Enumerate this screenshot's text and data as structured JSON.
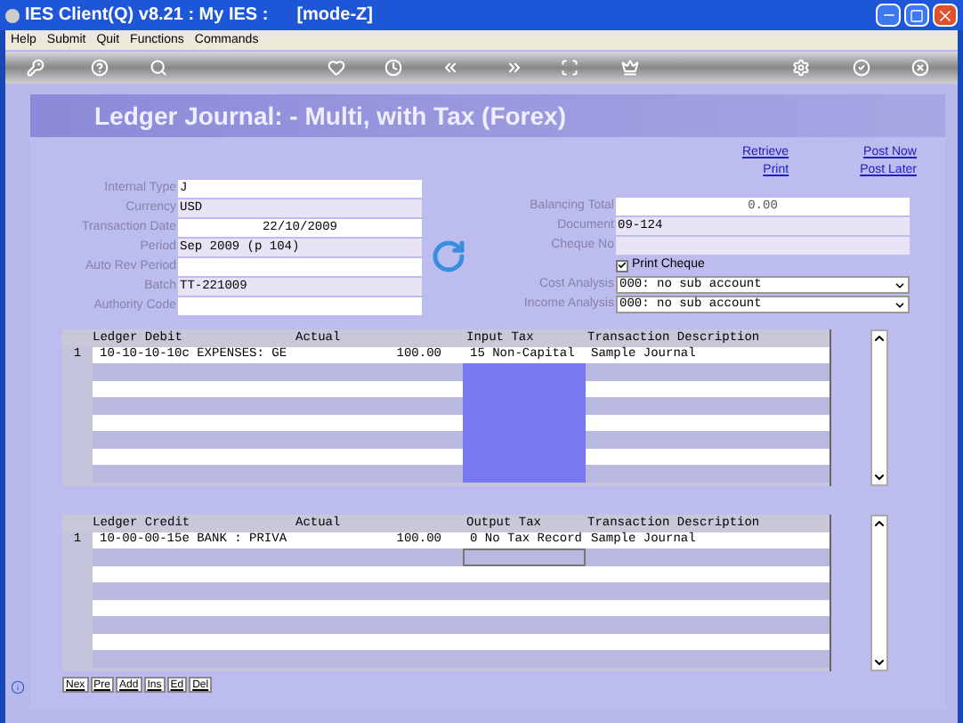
{
  "window": {
    "title": "IES Client(Q) v8.21 : My IES :",
    "mode": "[mode-Z]"
  },
  "menu": [
    "Help",
    "Submit",
    "Quit",
    "Functions",
    "Commands"
  ],
  "heading": "Ledger Journal: - Multi, with Tax (Forex)",
  "links": [
    {
      "label": "Retrieve"
    },
    {
      "label": "Post Now"
    },
    {
      "label": "Print"
    },
    {
      "label": "Post Later"
    }
  ],
  "left_fields": [
    {
      "kind": "text",
      "label": "Internal Type",
      "value": "J"
    },
    {
      "kind": "text",
      "label": "Currency",
      "value": "USD"
    },
    {
      "kind": "date",
      "label": "Transaction Date",
      "value": "22/10/2009"
    },
    {
      "kind": "text",
      "label": "Period",
      "value": "Sep 2009 (p 104)"
    },
    {
      "kind": "text",
      "label": "Auto Rev Period"
    },
    {
      "kind": "text",
      "label": "Batch",
      "value": "TT-221009"
    },
    {
      "kind": "text",
      "label": "Authority Code"
    }
  ],
  "right_fields": [
    {
      "kind": "total",
      "label": "Balancing Total",
      "value": "0.00"
    },
    {
      "kind": "text",
      "label": "Document",
      "value": "09-124"
    },
    {
      "kind": "text",
      "label": "Cheque No"
    },
    {
      "kind": "checkbox",
      "label": "Print Cheque",
      "checked": true
    },
    {
      "kind": "select",
      "label": "Cost Analysis",
      "value": "000: no sub account"
    },
    {
      "kind": "select",
      "label": "Income Analysis",
      "value": "000: no sub account"
    }
  ],
  "debit_grid": {
    "columns": [
      "Ledger Debit",
      "Actual",
      "Input Tax",
      "Transaction Description"
    ],
    "tax_highlighted": true,
    "tax_focused": false,
    "rows": [
      {
        "number": "1",
        "ledger": "10-10-10-10c EXPENSES: GE",
        "actual": "100.00",
        "tax": "15 Non-Capital",
        "description": "Sample Journal"
      }
    ]
  },
  "credit_grid": {
    "columns": [
      "Ledger Credit",
      "Actual",
      "Output Tax",
      "Transaction Description"
    ],
    "tax_highlighted": false,
    "tax_focused": true,
    "rows": [
      {
        "number": "1",
        "ledger": "10-00-00-15e BANK : PRIVA",
        "actual": "100.00",
        "tax": "0 No Tax Record",
        "description": "Sample Journal"
      }
    ]
  },
  "row_buttons": [
    "Nex",
    "Pre",
    "Add",
    "Ins",
    "Ed",
    "Del"
  ]
}
